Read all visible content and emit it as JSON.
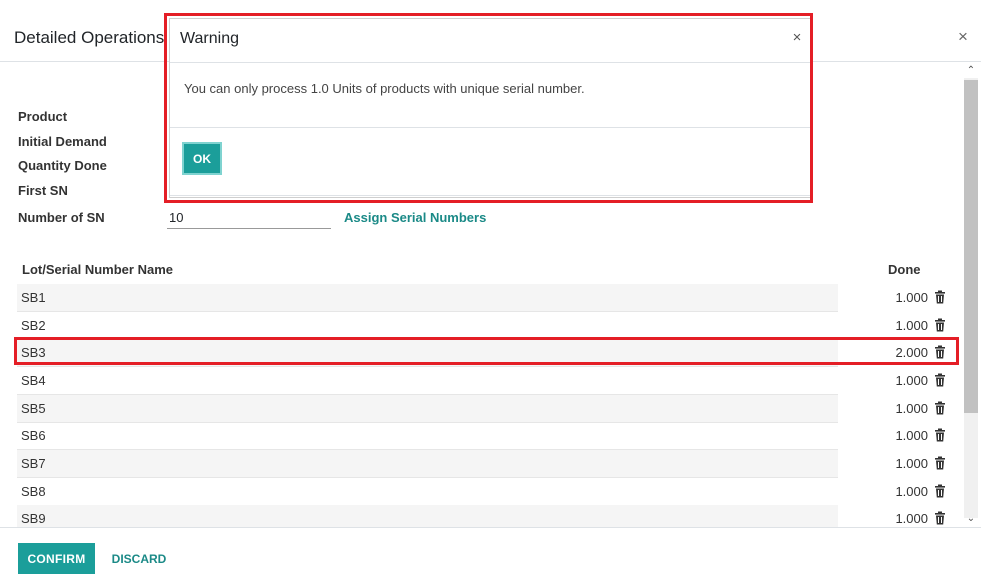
{
  "dialog": {
    "title": "Detailed Operations",
    "close_icon": "×"
  },
  "form": {
    "product_label": "Product",
    "initial_demand_label": "Initial Demand",
    "quantity_done_label": "Quantity Done",
    "first_sn_label": "First SN",
    "number_of_sn_label": "Number of SN",
    "number_of_sn_value": "10",
    "assign_link": "Assign Serial Numbers"
  },
  "table": {
    "columns": [
      "Lot/Serial Number Name",
      "Done"
    ],
    "rows": [
      {
        "name": "SB1",
        "done": "1.000"
      },
      {
        "name": "SB2",
        "done": "1.000"
      },
      {
        "name": "SB3",
        "done": "2.000"
      },
      {
        "name": "SB4",
        "done": "1.000"
      },
      {
        "name": "SB5",
        "done": "1.000"
      },
      {
        "name": "SB6",
        "done": "1.000"
      },
      {
        "name": "SB7",
        "done": "1.000"
      },
      {
        "name": "SB8",
        "done": "1.000"
      },
      {
        "name": "SB9",
        "done": "1.000"
      }
    ]
  },
  "footer": {
    "confirm": "CONFIRM",
    "discard": "DISCARD"
  },
  "warning": {
    "title": "Warning",
    "close_icon": "×",
    "message": "You can only process 1.0 Units of products with unique serial number.",
    "ok": "OK"
  },
  "scrollbar": {
    "up_icon": "⌃",
    "down_icon": "⌄"
  },
  "colors": {
    "accent": "#1b9e9a",
    "highlight": "#e41e26"
  }
}
